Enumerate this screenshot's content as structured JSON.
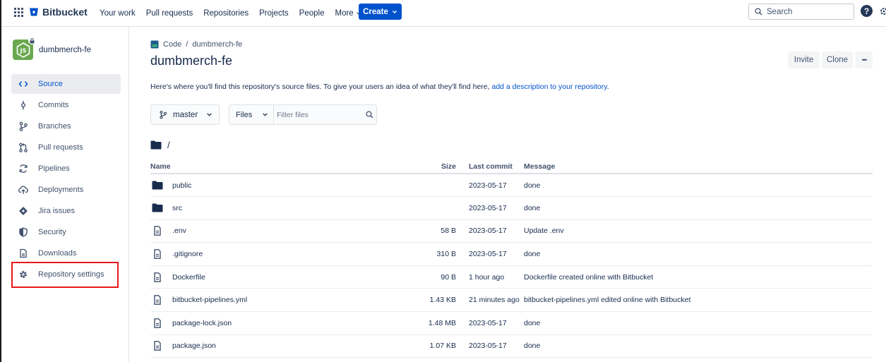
{
  "nav": {
    "brand": "Bitbucket",
    "links": [
      "Your work",
      "Pull requests",
      "Repositories",
      "Projects",
      "People"
    ],
    "more_label": "More",
    "create_label": "Create",
    "search_placeholder": "Search"
  },
  "sidebar": {
    "repo_name": "dumbmerch-fe",
    "items": [
      {
        "label": "Source",
        "icon": "code-icon",
        "active": true
      },
      {
        "label": "Commits",
        "icon": "commit-icon"
      },
      {
        "label": "Branches",
        "icon": "branch-icon"
      },
      {
        "label": "Pull requests",
        "icon": "pull-request-icon"
      },
      {
        "label": "Pipelines",
        "icon": "pipelines-icon"
      },
      {
        "label": "Deployments",
        "icon": "deployments-icon"
      },
      {
        "label": "Jira issues",
        "icon": "jira-icon"
      },
      {
        "label": "Security",
        "icon": "shield-icon"
      },
      {
        "label": "Downloads",
        "icon": "download-file-icon"
      },
      {
        "label": "Repository settings",
        "icon": "gear-icon",
        "highlighted": true
      }
    ]
  },
  "main": {
    "breadcrumb": {
      "section": "Code",
      "separator": "/",
      "repo": "dumbmerch-fe"
    },
    "title": "dumbmerch-fe",
    "invite_label": "Invite",
    "clone_label": "Clone",
    "more_actions": "•••",
    "description_text": "Here's where you'll find this repository's source files. To give your users an idea of what they'll find here,",
    "description_link": "add a description to your repository",
    "description_end": ".",
    "branch": "master",
    "files_select": "Files",
    "filter_placeholder": "Filter files",
    "path": "/",
    "columns": {
      "name": "Name",
      "size": "Size",
      "last_commit": "Last commit",
      "message": "Message"
    },
    "files": [
      {
        "type": "folder",
        "name": "public",
        "size": "",
        "last_commit": "2023-05-17",
        "message": "done"
      },
      {
        "type": "folder",
        "name": "src",
        "size": "",
        "last_commit": "2023-05-17",
        "message": "done"
      },
      {
        "type": "file",
        "name": ".env",
        "size": "58 B",
        "last_commit": "2023-05-17",
        "message": "Update .env"
      },
      {
        "type": "file",
        "name": ".gitignore",
        "size": "310 B",
        "last_commit": "2023-05-17",
        "message": "done"
      },
      {
        "type": "file",
        "name": "Dockerfile",
        "size": "90 B",
        "last_commit": "1 hour ago",
        "message": "Dockerfile created online with Bitbucket"
      },
      {
        "type": "file",
        "name": "bitbucket-pipelines.yml",
        "size": "1.43 KB",
        "last_commit": "21 minutes ago",
        "message": "bitbucket-pipelines.yml edited online with Bitbucket"
      },
      {
        "type": "file",
        "name": "package-lock.json",
        "size": "1.48 MB",
        "last_commit": "2023-05-17",
        "message": "done"
      },
      {
        "type": "file",
        "name": "package.json",
        "size": "1.07 KB",
        "last_commit": "2023-05-17",
        "message": "done"
      }
    ]
  },
  "colors": {
    "brand_blue": "#0052cc",
    "text": "#172b4d",
    "subtle": "#42526e",
    "highlight_red": "#e5181b",
    "avatar_green": "#6aa84f"
  }
}
